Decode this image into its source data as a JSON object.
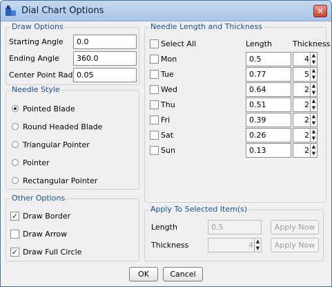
{
  "window": {
    "title": "Dial Chart Options",
    "close_label": "✕"
  },
  "draw_options": {
    "legend": "Draw Options",
    "fields": [
      {
        "label": "Starting Angle",
        "value": "0.0"
      },
      {
        "label": "Ending Angle",
        "value": "360.0"
      },
      {
        "label": "Center Point Radius",
        "value": "0.05"
      }
    ]
  },
  "needle_style": {
    "legend": "Needle Style",
    "options": [
      {
        "label": "Pointed Blade",
        "selected": true
      },
      {
        "label": "Round Headed Blade",
        "selected": false
      },
      {
        "label": "Triangular Pointer",
        "selected": false
      },
      {
        "label": "Pointer",
        "selected": false
      },
      {
        "label": "Rectangular Pointer",
        "selected": false
      }
    ]
  },
  "other_options": {
    "legend": "Other Options",
    "options": [
      {
        "label": "Draw Border",
        "checked": true
      },
      {
        "label": "Draw Arrow",
        "checked": false
      },
      {
        "label": "Draw Full Circle",
        "checked": true
      }
    ]
  },
  "needle_table": {
    "legend": "Needle Length and Thickness",
    "select_all_label": "Select All",
    "length_header": "Length",
    "thickness_header": "Thickness",
    "rows": [
      {
        "day": "Mon",
        "length": "0.5",
        "thickness": "4"
      },
      {
        "day": "Tue",
        "length": "0.77",
        "thickness": "5"
      },
      {
        "day": "Wed",
        "length": "0.64",
        "thickness": "2"
      },
      {
        "day": "Thu",
        "length": "0.51",
        "thickness": "2"
      },
      {
        "day": "Fri",
        "length": "0.39",
        "thickness": "2"
      },
      {
        "day": "Sat",
        "length": "0.26",
        "thickness": "2"
      },
      {
        "day": "Sun",
        "length": "0.13",
        "thickness": "2"
      }
    ]
  },
  "apply_selected": {
    "legend": "Apply To Selected Item(s)",
    "length_label": "Length",
    "length_value": "0.5",
    "thickness_label": "Thickness",
    "thickness_value": "4",
    "apply_label": "Apply Now"
  },
  "footer": {
    "ok_label": "OK",
    "cancel_label": "Cancel"
  },
  "icons": {
    "check": "✓",
    "spin_up": "▲",
    "spin_down": "▼"
  }
}
